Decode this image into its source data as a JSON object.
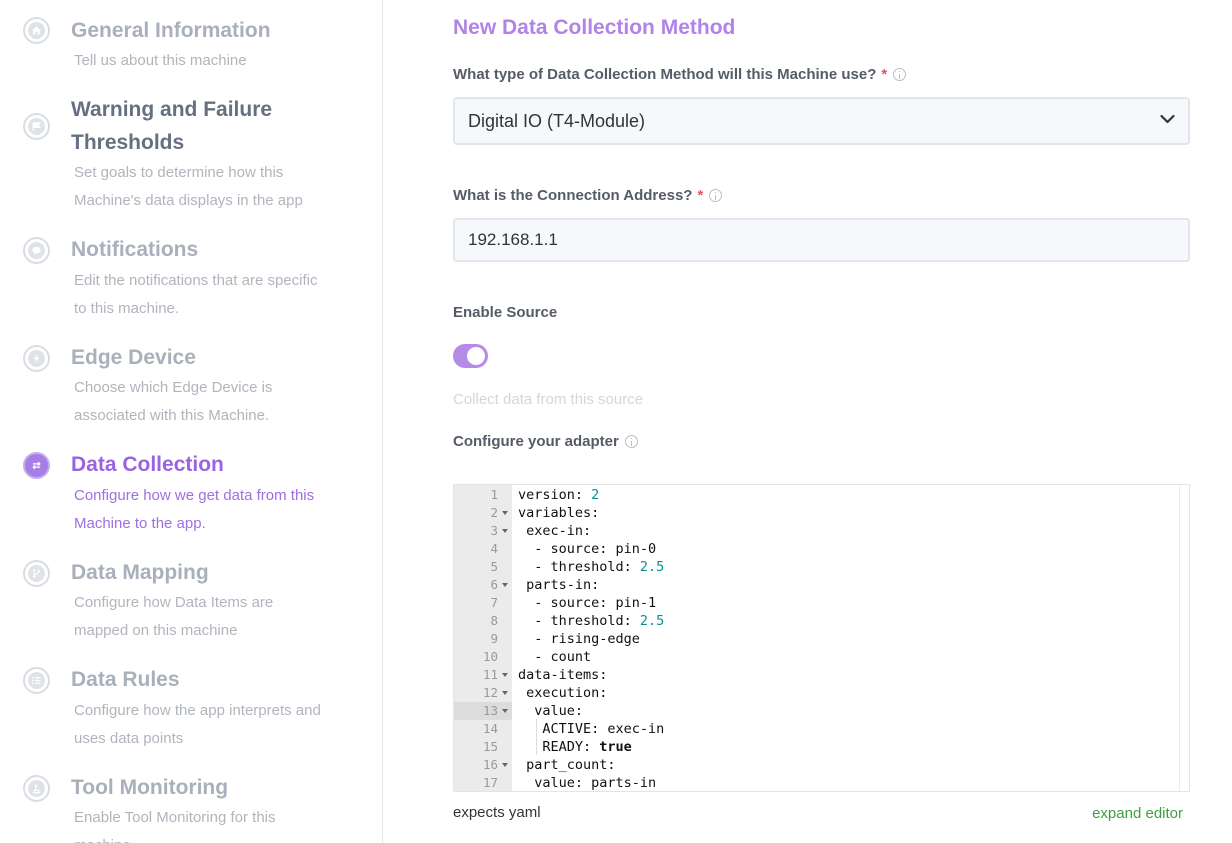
{
  "sidebar": {
    "steps": [
      {
        "title": "General Information",
        "desc": "Tell us about this machine",
        "icon": "home-icon"
      },
      {
        "title": "Warning and Failure Thresholds",
        "desc": "Set goals to determine how this Machine's data displays in the app",
        "icon": "flag-icon"
      },
      {
        "title": "Notifications",
        "desc": "Edit the notifications that are specific to this machine.",
        "icon": "chat-bubble-icon"
      },
      {
        "title": "Edge Device",
        "desc": "Choose which Edge Device is associated with this Machine.",
        "icon": "lightning-bolt-icon"
      },
      {
        "title": "Data Collection",
        "desc": "Configure how we get data from this Machine to the app.",
        "icon": "arrows-exchange-icon"
      },
      {
        "title": "Data Mapping",
        "desc": "Configure how Data Items are mapped on this machine",
        "icon": "branch-icon"
      },
      {
        "title": "Data Rules",
        "desc": "Configure how the app interprets and uses data points",
        "icon": "list-icon"
      },
      {
        "title": "Tool Monitoring",
        "desc": "Enable Tool Monitoring for this machine",
        "icon": "tool-icon"
      }
    ],
    "active_index": 4
  },
  "form": {
    "title": "New Data Collection Method",
    "method_label": "What type of Data Collection Method will this Machine use?",
    "method_required": "*",
    "method_value": "Digital IO (T4-Module)",
    "address_label": "What is the Connection Address?",
    "address_required": "*",
    "address_value": "192.168.1.1",
    "enable_label": "Enable Source",
    "enable_on": true,
    "enable_helper": "Collect data from this source",
    "adapter_label": "Configure your adapter",
    "expects": "expects yaml",
    "expand_editor": "expand editor"
  },
  "editor": {
    "current_line": 13,
    "lines": [
      {
        "n": "1",
        "fold": false,
        "text": "version: ",
        "num": "2"
      },
      {
        "n": "2",
        "fold": true,
        "text": "variables:"
      },
      {
        "n": "3",
        "fold": true,
        "text": " exec-in:"
      },
      {
        "n": "4",
        "fold": false,
        "text": "  - source: pin-0"
      },
      {
        "n": "5",
        "fold": false,
        "text": "  - threshold: ",
        "num": "2.5"
      },
      {
        "n": "6",
        "fold": true,
        "text": " parts-in:"
      },
      {
        "n": "7",
        "fold": false,
        "text": "  - source: pin-1"
      },
      {
        "n": "8",
        "fold": false,
        "text": "  - threshold: ",
        "num": "2.5"
      },
      {
        "n": "9",
        "fold": false,
        "text": "  - rising-edge"
      },
      {
        "n": "10",
        "fold": false,
        "text": "  - count"
      },
      {
        "n": "11",
        "fold": true,
        "text": "data-items:"
      },
      {
        "n": "12",
        "fold": true,
        "text": " execution:"
      },
      {
        "n": "13",
        "fold": true,
        "text": "  value:"
      },
      {
        "n": "14",
        "fold": false,
        "text": "   ACTIVE: exec-in"
      },
      {
        "n": "15",
        "fold": false,
        "text": "   READY: ",
        "bool": "true"
      },
      {
        "n": "16",
        "fold": true,
        "text": " part_count:"
      },
      {
        "n": "17",
        "fold": false,
        "text": "  value: parts-in"
      }
    ]
  },
  "colors": {
    "accent": "#a77ee6",
    "required": "#e0555f",
    "link_green": "#3ea03e"
  }
}
